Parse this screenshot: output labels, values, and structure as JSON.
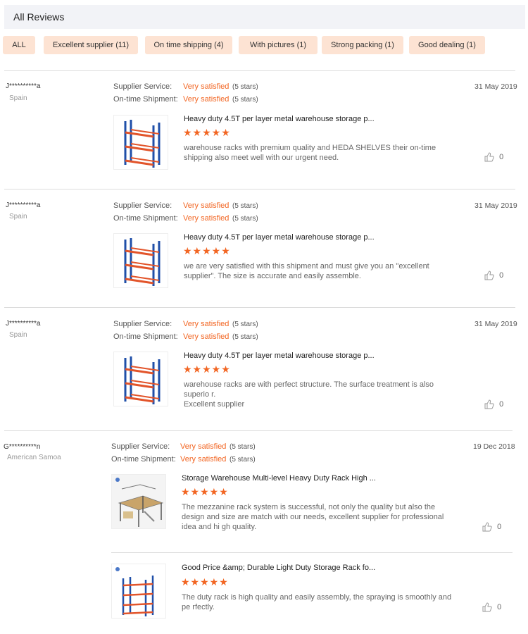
{
  "header": {
    "title": "All Reviews"
  },
  "filters": [
    {
      "label": "ALL"
    },
    {
      "label": "Excellent supplier (11)"
    },
    {
      "label": "On time shipping (4)"
    },
    {
      "label": "With pictures (1)"
    },
    {
      "label": "Strong packing (1)"
    },
    {
      "label": "Good dealing (1)"
    }
  ],
  "labels": {
    "supplier_service": "Supplier Service:",
    "ontime_shipment": "On-time Shipment:"
  },
  "reviews": [
    {
      "user": "J**********a",
      "country": "Spain",
      "date": "31 May 2019",
      "supplier_value": "Very satisfied",
      "supplier_stars": "(5 stars)",
      "shipment_value": "Very satisfied",
      "shipment_stars": "(5 stars)",
      "products": [
        {
          "title": "Heavy duty 4.5T per layer metal warehouse storage p...",
          "stars": "★★★★★",
          "text": "warehouse racks with premium quality and HEDA SHELVES their on-time shipping also meet well with our urgent need.",
          "likes": "0",
          "image": "pallet-rack-image"
        }
      ]
    },
    {
      "user": "J**********a",
      "country": "Spain",
      "date": "31 May 2019",
      "supplier_value": "Very satisfied",
      "supplier_stars": "(5 stars)",
      "shipment_value": "Very satisfied",
      "shipment_stars": "(5 stars)",
      "products": [
        {
          "title": "Heavy duty 4.5T per layer metal warehouse storage p...",
          "stars": "★★★★★",
          "text": "we are very satisfied with this shipment and must give you an \"excellent supplier\". The size is accurate and easily assemble.",
          "likes": "0",
          "image": "pallet-rack-image"
        }
      ]
    },
    {
      "user": "J**********a",
      "country": "Spain",
      "date": "31 May 2019",
      "supplier_value": "Very satisfied",
      "supplier_stars": "(5 stars)",
      "shipment_value": "Very satisfied",
      "shipment_stars": "(5 stars)",
      "products": [
        {
          "title": "Heavy duty 4.5T per layer metal warehouse storage p...",
          "stars": "★★★★★",
          "text": "warehouse racks are with perfect structure. The surface treatment is also superio r.",
          "text2": "Excellent supplier",
          "likes": "0",
          "image": "pallet-rack-image"
        }
      ]
    },
    {
      "user": "G**********n",
      "country": "American Samoa",
      "date": "19 Dec 2018",
      "supplier_value": "Very satisfied",
      "supplier_stars": "(5 stars)",
      "shipment_value": "Very satisfied",
      "shipment_stars": "(5 stars)",
      "products": [
        {
          "title": "Storage Warehouse Multi-level Heavy Duty Rack High ...",
          "stars": "★★★★★",
          "text": "The mezzanine rack system is successful, not only the quality but also the design and size are match with our needs, excellent supplier for professional idea and hi gh quality.",
          "likes": "0",
          "image": "mezzanine-rack-image"
        },
        {
          "title": "Good Price &amp; Durable Light Duty Storage Rack fo...",
          "stars": "★★★★★",
          "text": "The duty rack is high quality and easily assembly, the spraying is smoothly and pe rfectly.",
          "likes": "0",
          "image": "light-duty-rack-image"
        }
      ]
    }
  ],
  "colors": {
    "accent": "#f26522",
    "chip_bg": "#fde3d3",
    "header_bg": "#f2f3f7"
  }
}
